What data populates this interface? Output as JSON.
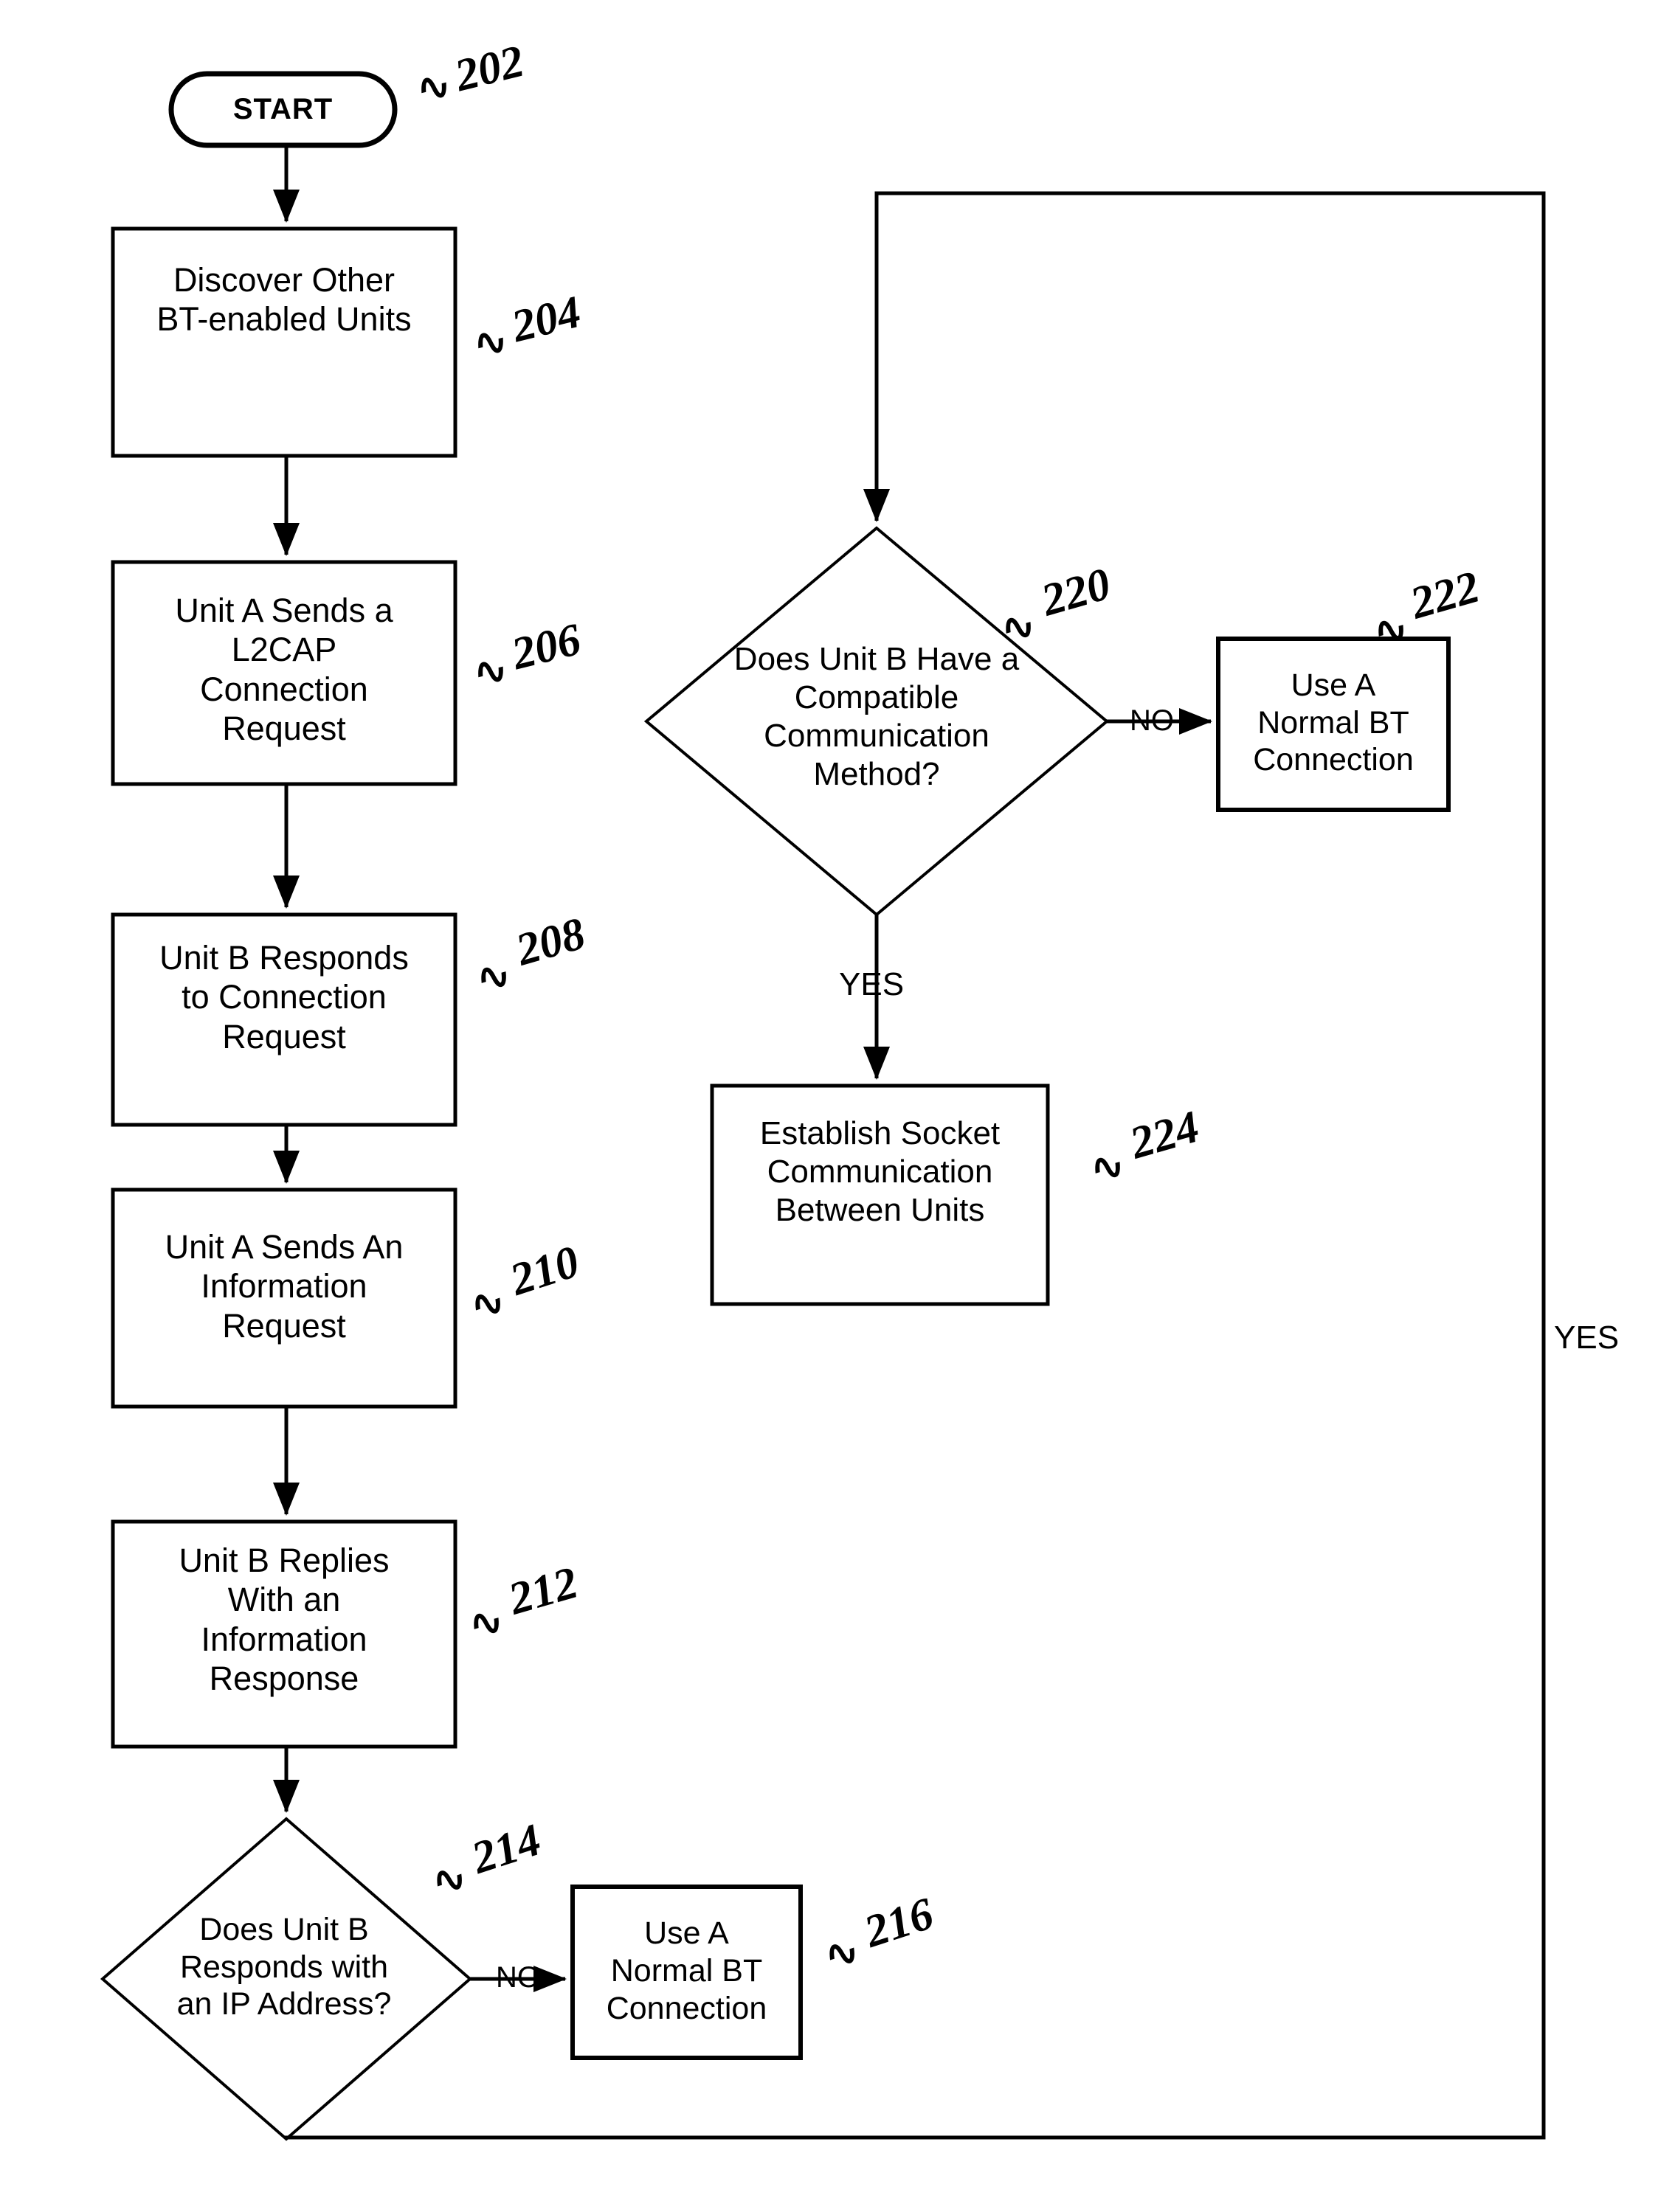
{
  "figure": {
    "type": "flowchart",
    "description": "Bluetooth connection establishment flowchart"
  },
  "nodes": {
    "start": {
      "label": "START",
      "shape": "terminator",
      "ref": "202"
    },
    "discover": {
      "label": "Discover Other\nBT-enabled Units",
      "shape": "process",
      "ref": "204"
    },
    "l2cap_request": {
      "label": "Unit A Sends a\nL2CAP\nConnection\nRequest",
      "shape": "process",
      "ref": "206"
    },
    "unit_b_responds": {
      "label": "Unit B Responds\nto Connection\nRequest",
      "shape": "process",
      "ref": "208"
    },
    "info_request": {
      "label": "Unit A Sends An\nInformation\nRequest",
      "shape": "process",
      "ref": "210"
    },
    "info_response": {
      "label": "Unit B Replies\nWith an\nInformation\nResponse",
      "shape": "process",
      "ref": "212"
    },
    "ip_decision": {
      "label": "Does Unit B\nResponds with\nan IP Address?",
      "shape": "decision",
      "ref": "214"
    },
    "normal_bt_1": {
      "label": "Use A\nNormal BT\nConnection",
      "shape": "process",
      "ref": "216"
    },
    "compat_decision": {
      "label": "Does Unit B Have a\nCompatible\nCommunication\nMethod?",
      "shape": "decision",
      "ref": "220"
    },
    "normal_bt_2": {
      "label": "Use A\nNormal BT\nConnection",
      "shape": "process",
      "ref": "222"
    },
    "socket_comm": {
      "label": "Establish Socket\nCommunication\nBetween Units",
      "shape": "process",
      "ref": "224"
    }
  },
  "edge_labels": {
    "ip_no": "NO",
    "ip_yes": "YES",
    "compat_no": "NO",
    "compat_yes": "YES"
  },
  "ref_marker": "∿",
  "colors": {
    "stroke": "#000000",
    "fill": "#ffffff",
    "text": "#000000"
  }
}
